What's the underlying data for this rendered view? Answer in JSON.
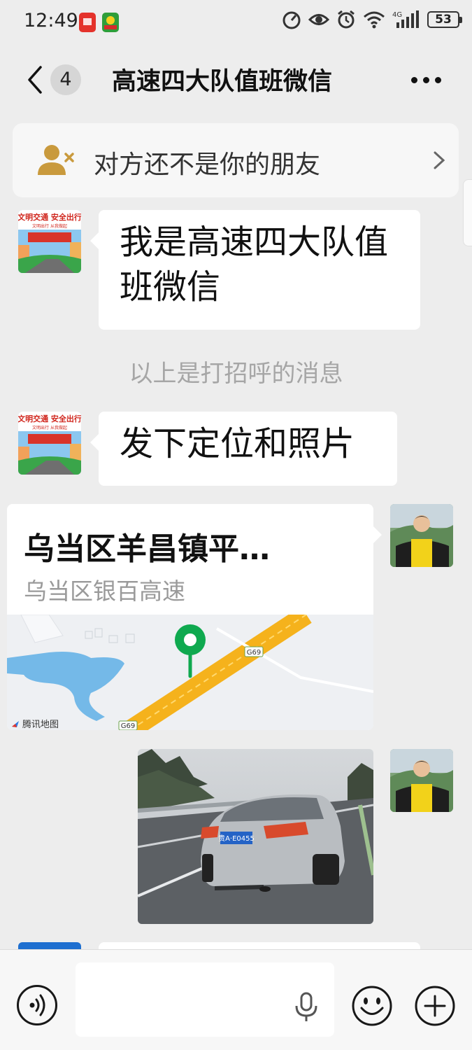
{
  "status_bar": {
    "time": "12:49",
    "battery": "53",
    "network": "4G",
    "app_icons": [
      "huawei-app-icon",
      "game-app-icon"
    ],
    "icons": [
      "hotspot-icon",
      "eye-icon",
      "alarm-icon",
      "wifi-icon",
      "signal-icon",
      "battery-icon"
    ]
  },
  "nav": {
    "unread_count": "4",
    "title": "高速四大队值班微信"
  },
  "notice": {
    "text": "对方还不是你的朋友"
  },
  "messages": {
    "m1": "我是高速四大队值班微信",
    "system": "以上是打招呼的消息",
    "m2": "发下定位和照片",
    "location": {
      "title": "乌当区羊昌镇平…",
      "subtitle": "乌当区银百高速",
      "map_provider": "腾讯地图",
      "road_labels": [
        "G69",
        "G69"
      ]
    },
    "photo": {
      "plate": "贵A·E0455"
    }
  },
  "sender_avatar_text": {
    "banner": "文明交通 安全出行",
    "sub": "文明出行 从我做起"
  },
  "input_bar": {
    "placeholder": ""
  },
  "colors": {
    "background": "#ededed",
    "bubble": "#ffffff",
    "map_pin": "#0fa94f",
    "highway": "#f5b21c"
  }
}
